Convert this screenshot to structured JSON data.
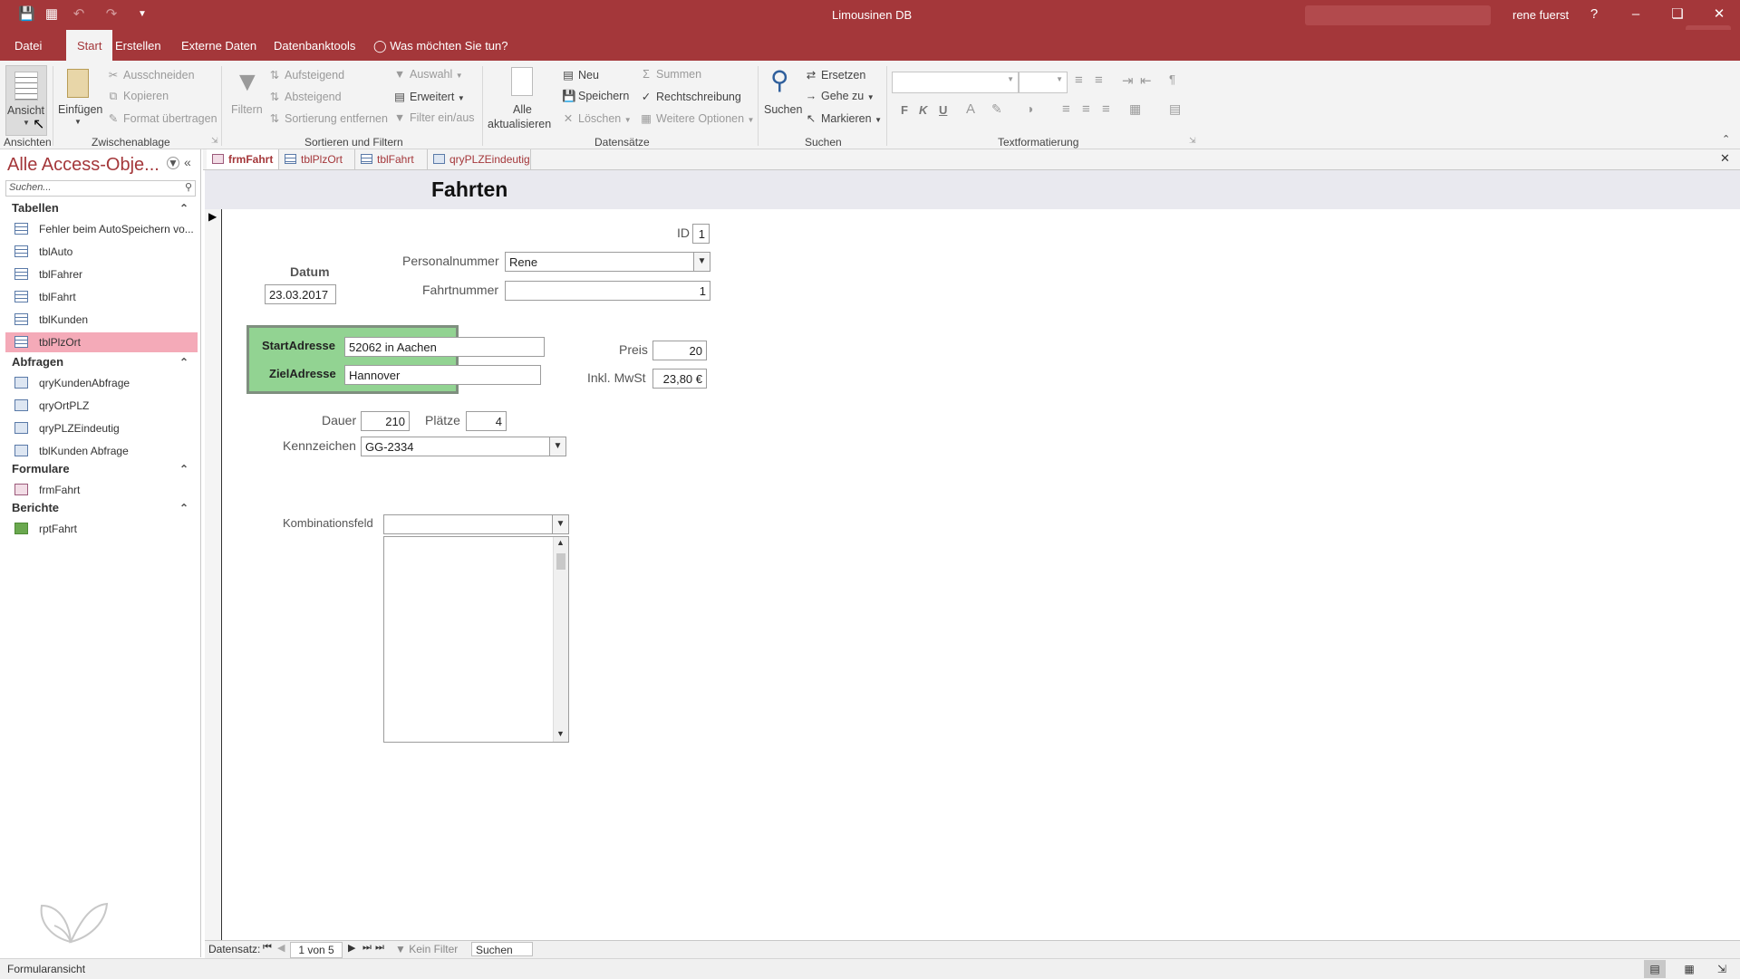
{
  "window": {
    "title": "Limousinen DB",
    "user": "rene fuerst",
    "help": "?"
  },
  "menu": {
    "tabs": [
      "Datei",
      "Start",
      "Erstellen",
      "Externe Daten",
      "Datenbanktools"
    ],
    "tell_me": "Was möchten Sie tun?"
  },
  "ribbon": {
    "ansicht": "Ansicht",
    "einfuegen": "Einfügen",
    "ausschneiden": "Ausschneiden",
    "kopieren": "Kopieren",
    "format_uebertragen": "Format übertragen",
    "filtern": "Filtern",
    "aufsteigend": "Aufsteigend",
    "absteigend": "Absteigend",
    "sortierung_entfernen": "Sortierung entfernen",
    "auswahl": "Auswahl",
    "erweitert": "Erweitert",
    "filter_ein_aus": "Filter ein/aus",
    "alle": "Alle",
    "aktualisieren": "aktualisieren",
    "neu": "Neu",
    "speichern": "Speichern",
    "loeschen": "Löschen",
    "summen": "Summen",
    "rechtschreibung": "Rechtschreibung",
    "weitere_optionen": "Weitere Optionen",
    "suchen": "Suchen",
    "ersetzen": "Ersetzen",
    "gehe_zu": "Gehe zu",
    "markieren": "Markieren",
    "bold": "F",
    "italic": "K",
    "underline": "U",
    "groups": {
      "ansichten": "Ansichten",
      "zwischenablage": "Zwischenablage",
      "sortieren": "Sortieren und Filtern",
      "datensaetze": "Datensätze",
      "suchen": "Suchen",
      "textformatierung": "Textformatierung"
    }
  },
  "nav": {
    "title": "Alle Access-Obje...",
    "search_placeholder": "Suchen...",
    "groups": [
      {
        "name": "Tabellen",
        "items": [
          "Fehler beim AutoSpeichern vo...",
          "tblAuto",
          "tblFahrer",
          "tblFahrt",
          "tblKunden",
          "tblPlzOrt"
        ]
      },
      {
        "name": "Abfragen",
        "items": [
          "qryKundenAbfrage",
          "qryOrtPLZ",
          "qryPLZEindeutig",
          "tblKunden Abfrage"
        ]
      },
      {
        "name": "Formulare",
        "items": [
          "frmFahrt"
        ]
      },
      {
        "name": "Berichte",
        "items": [
          "rptFahrt"
        ]
      }
    ],
    "selected": "tblPlzOrt"
  },
  "doc_tabs": [
    "frmFahrt",
    "tblPlzOrt",
    "tblFahrt",
    "qryPLZEindeutig"
  ],
  "form": {
    "title": "Fahrten",
    "id_label": "ID",
    "id_value": "1",
    "datum_label": "Datum",
    "datum_value": "23.03.2017",
    "personalnummer_label": "Personalnummer",
    "personalnummer_value": "Rene",
    "fahrtnummer_label": "Fahrtnummer",
    "fahrtnummer_value": "1",
    "start_label": "StartAdresse",
    "start_value": "52062 in Aachen",
    "ziel_label": "ZielAdresse",
    "ziel_value": "Hannover",
    "preis_label": "Preis",
    "preis_value": "20",
    "mwst_label": "Inkl. MwSt",
    "mwst_value": "23,80 €",
    "dauer_label": "Dauer",
    "dauer_value": "210",
    "plaetze_label": "Plätze",
    "plaetze_value": "4",
    "kennzeichen_label": "Kennzeichen",
    "kennzeichen_value": "GG-2334",
    "kombi_label": "Kombinationsfeld",
    "kombi_value": ""
  },
  "record_nav": {
    "label": "Datensatz:",
    "position": "1 von 5",
    "filter": "Kein Filter",
    "search": "Suchen"
  },
  "status": {
    "view": "Formularansicht"
  },
  "colors": {
    "accent": "#a4373a",
    "address_box": "#92d392",
    "selected_item": "#f4aab8"
  }
}
